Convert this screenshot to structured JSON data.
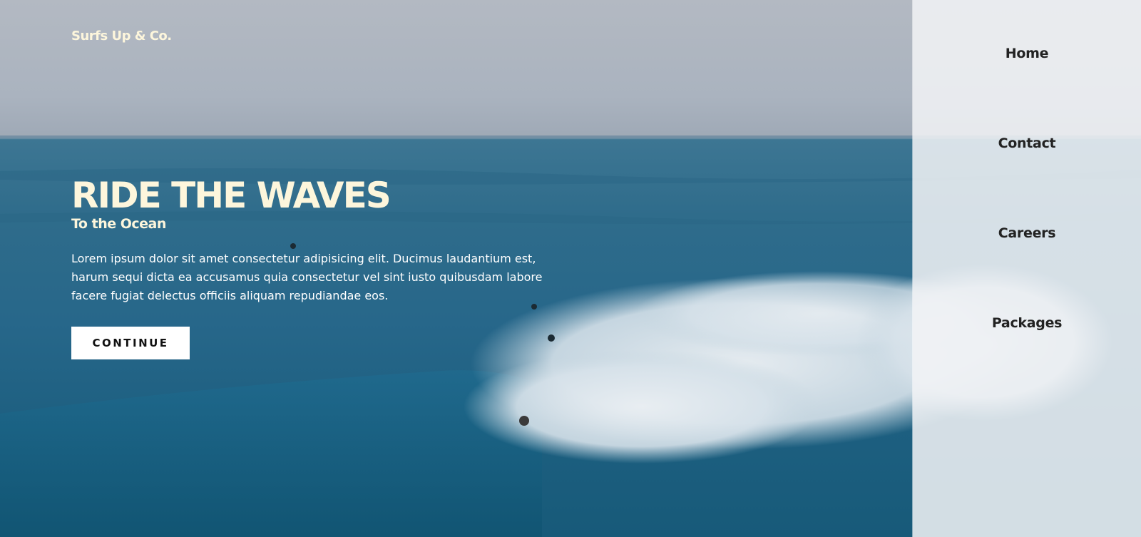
{
  "brand": {
    "logo_text": "Surfs Up & Co."
  },
  "hero": {
    "title": "RIDE THE WAVES",
    "subtitle": "To the Ocean",
    "description": "Lorem ipsum dolor sit amet consectetur adipisicing elit. Ducimus laudantium est, harum sequi dicta ea accusamus quia consectetur vel sint iusto quibusdam labore facere fugiat delectus officiis aliquam repudiandae eos.",
    "cta_label": "CONTINUE"
  },
  "nav": {
    "items": [
      {
        "label": "Home"
      },
      {
        "label": "Contact"
      },
      {
        "label": "Careers"
      },
      {
        "label": "Packages"
      }
    ]
  },
  "colors": {
    "accent_text": "#fdf6dc",
    "nav_text": "#222222",
    "nav_background": "#f2f3f6",
    "ocean": "#27678a",
    "sky": "#aab3bf"
  }
}
